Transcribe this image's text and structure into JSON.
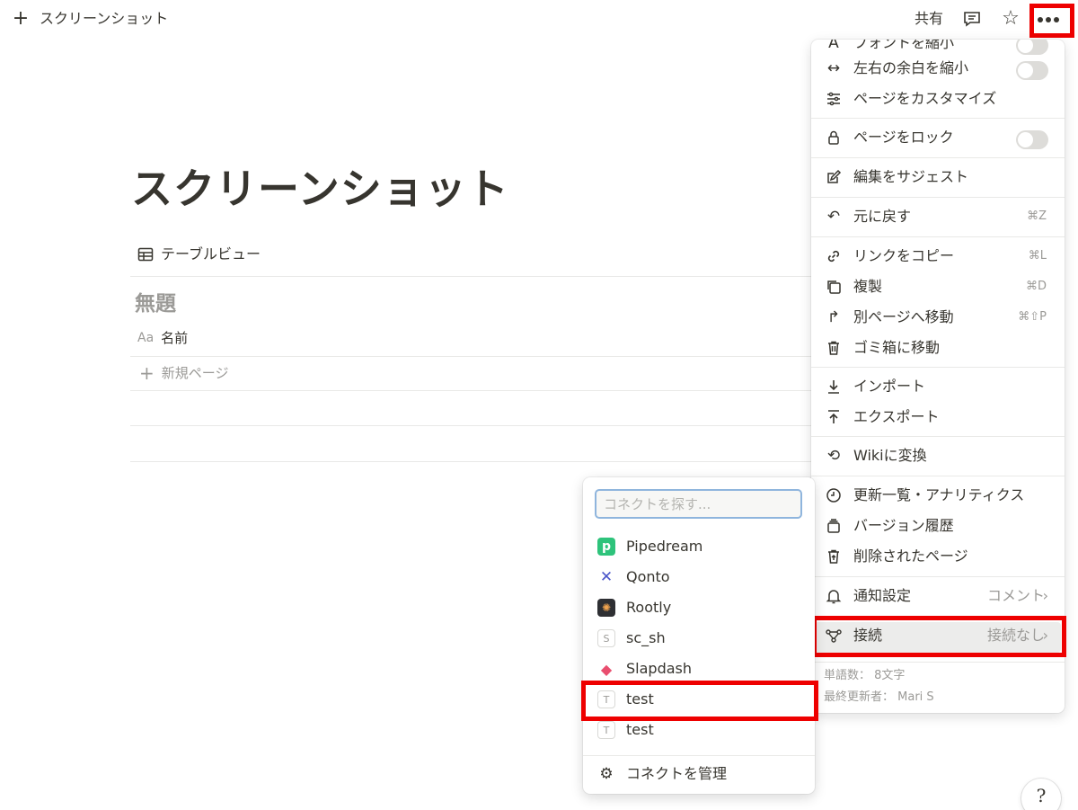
{
  "topbar": {
    "new_icon": "plus-icon",
    "title": "スクリーンショット",
    "share_label": "共有",
    "comment_icon": "comment-icon",
    "favorite_icon": "star-icon",
    "more_icon": "more-horizontal-icon"
  },
  "page": {
    "title": "スクリーンショット",
    "view_tab": "テーブルビュー",
    "group_title": "無題",
    "property_type": "Aa",
    "property_name": "名前",
    "new_page": "新規ページ"
  },
  "menu": {
    "partial_item": "フォントを縮小",
    "items": [
      {
        "label": "左右の余白を縮小",
        "icon": "arrows-horizontal-icon"
      },
      {
        "label": "ページをカスタマイズ",
        "icon": "sliders-icon"
      },
      {
        "label": "ページをロック",
        "icon": "lock-icon"
      },
      {
        "label": "編集をサジェスト",
        "icon": "suggest-edit-icon"
      },
      {
        "label": "元に戻す",
        "icon": "undo-icon",
        "shortcut": "⌘Z"
      },
      {
        "label": "リンクをコピー",
        "icon": "link-icon",
        "shortcut": "⌘L"
      },
      {
        "label": "複製",
        "icon": "duplicate-icon",
        "shortcut": "⌘D"
      },
      {
        "label": "別ページへ移動",
        "icon": "move-arrow-icon",
        "shortcut": "⌘⇧P"
      },
      {
        "label": "ゴミ箱に移動",
        "icon": "trash-icon"
      },
      {
        "label": "インポート",
        "icon": "import-icon"
      },
      {
        "label": "エクスポート",
        "icon": "export-icon"
      },
      {
        "label": "Wikiに変換",
        "icon": "convert-icon"
      },
      {
        "label": "更新一覧・アナリティクス",
        "icon": "clock-icon"
      },
      {
        "label": "バージョン履歴",
        "icon": "history-icon"
      },
      {
        "label": "削除されたページ",
        "icon": "deleted-pages-icon"
      },
      {
        "label": "通知設定",
        "icon": "bell-icon",
        "value": "コメント"
      },
      {
        "label": "接続",
        "icon": "connections-icon",
        "value": "接続なし"
      }
    ],
    "footer": {
      "word_count": "単語数： 8文字",
      "last_edited": "最終更新者： Mari S"
    }
  },
  "connections": {
    "search_placeholder": "コネクトを探す...",
    "items": [
      {
        "label": "Pipedream",
        "icon": "pipedream-logo-icon",
        "glyph": "p"
      },
      {
        "label": "Qonto",
        "icon": "qonto-logo-icon",
        "glyph": "✕"
      },
      {
        "label": "Rootly",
        "icon": "rootly-logo-icon",
        "glyph": "✺"
      },
      {
        "label": "sc_sh",
        "icon": "letter-s-icon",
        "glyph": "S"
      },
      {
        "label": "Slapdash",
        "icon": "slapdash-logo-icon",
        "glyph": "◆"
      },
      {
        "label": "test",
        "icon": "letter-t-icon",
        "glyph": "T"
      },
      {
        "label": "test",
        "icon": "letter-t-icon",
        "glyph": "T"
      }
    ],
    "manage_label": "コネクトを管理",
    "manage_icon": "gear-icon"
  },
  "help": {
    "icon": "help-icon",
    "glyph": "?"
  },
  "colors": {
    "highlight": "#ee0000",
    "text": "#37352f",
    "muted": "#9b9a97",
    "focus_border": "#8fb5dd"
  }
}
